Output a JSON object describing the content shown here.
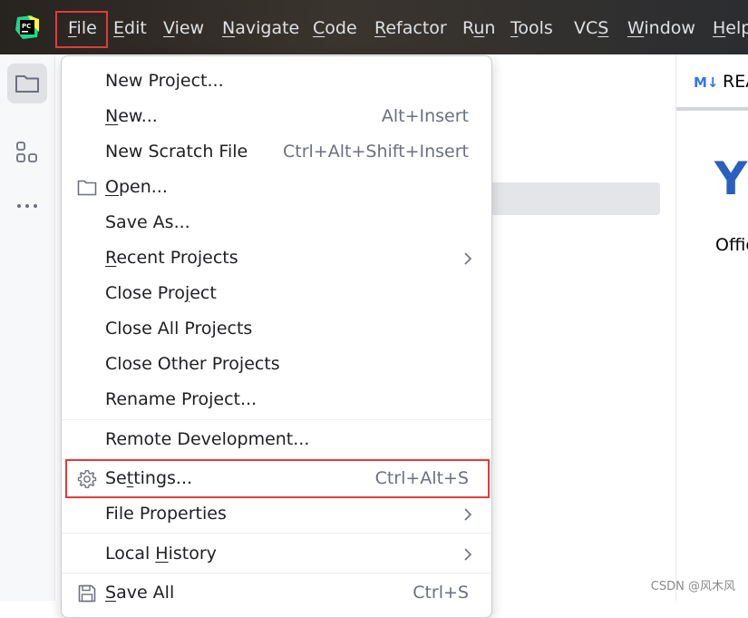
{
  "app": {
    "logo_text": "PC"
  },
  "menubar": {
    "items": [
      {
        "label": "File",
        "mnemonic": "F",
        "rest": "ile"
      },
      {
        "label": "Edit",
        "mnemonic": "E",
        "rest": "dit"
      },
      {
        "label": "View",
        "mnemonic": "V",
        "rest": "iew"
      },
      {
        "label": "Navigate",
        "mnemonic": "N",
        "rest": "avigate"
      },
      {
        "label": "Code",
        "mnemonic": "C",
        "rest": "ode"
      },
      {
        "label": "Refactor",
        "mnemonic": "R",
        "rest": "efactor"
      },
      {
        "label": "Run",
        "pre": "R",
        "mnemonic": "u",
        "rest": "n"
      },
      {
        "label": "Tools",
        "mnemonic": "T",
        "rest": "ools"
      },
      {
        "label": "VCS",
        "pre": "VC",
        "mnemonic": "S",
        "rest": ""
      },
      {
        "label": "Window",
        "mnemonic": "W",
        "rest": "indow"
      },
      {
        "label": "Help",
        "mnemonic": "H",
        "rest": "elp"
      }
    ]
  },
  "toolstrip": {
    "icons": [
      "folder-icon",
      "structure-icon",
      "more-icon"
    ]
  },
  "editor": {
    "tab_icon": "M↓",
    "tab_label": "README.md",
    "heading": "YC",
    "text": "Offic"
  },
  "file_menu": {
    "items": [
      {
        "pre": "",
        "mnemonic": "",
        "rest": "New Project...",
        "shortcut": ""
      },
      {
        "pre": "",
        "mnemonic": "N",
        "rest": "ew...",
        "shortcut": "Alt+Insert"
      },
      {
        "pre": "",
        "mnemonic": "",
        "rest": "New Scratch File",
        "shortcut": "Ctrl+Alt+Shift+Insert"
      },
      {
        "pre": "",
        "mnemonic": "O",
        "rest": "pen...",
        "shortcut": ""
      },
      {
        "pre": "",
        "mnemonic": "",
        "rest": "Save As...",
        "shortcut": ""
      },
      {
        "pre": "",
        "mnemonic": "R",
        "rest": "ecent Projects",
        "shortcut": ""
      },
      {
        "pre": "Close Pro",
        "mnemonic": "j",
        "rest": "ect",
        "shortcut": ""
      },
      {
        "pre": "",
        "mnemonic": "",
        "rest": "Close All Projects",
        "shortcut": ""
      },
      {
        "pre": "",
        "mnemonic": "",
        "rest": "Close Other Projects",
        "shortcut": ""
      },
      {
        "pre": "",
        "mnemonic": "",
        "rest": "Rename Project...",
        "shortcut": ""
      },
      {
        "pre": "",
        "mnemonic": "",
        "rest": "Remote Development...",
        "shortcut": ""
      },
      {
        "pre": "Se",
        "mnemonic": "t",
        "rest": "tings...",
        "shortcut": "Ctrl+Alt+S"
      },
      {
        "pre": "",
        "mnemonic": "",
        "rest": "File Properties",
        "shortcut": ""
      },
      {
        "pre": "Local ",
        "mnemonic": "H",
        "rest": "istory",
        "shortcut": ""
      },
      {
        "pre": "",
        "mnemonic": "S",
        "rest": "ave All",
        "shortcut": "Ctrl+S"
      }
    ]
  },
  "watermark": "CSDN @风木风"
}
